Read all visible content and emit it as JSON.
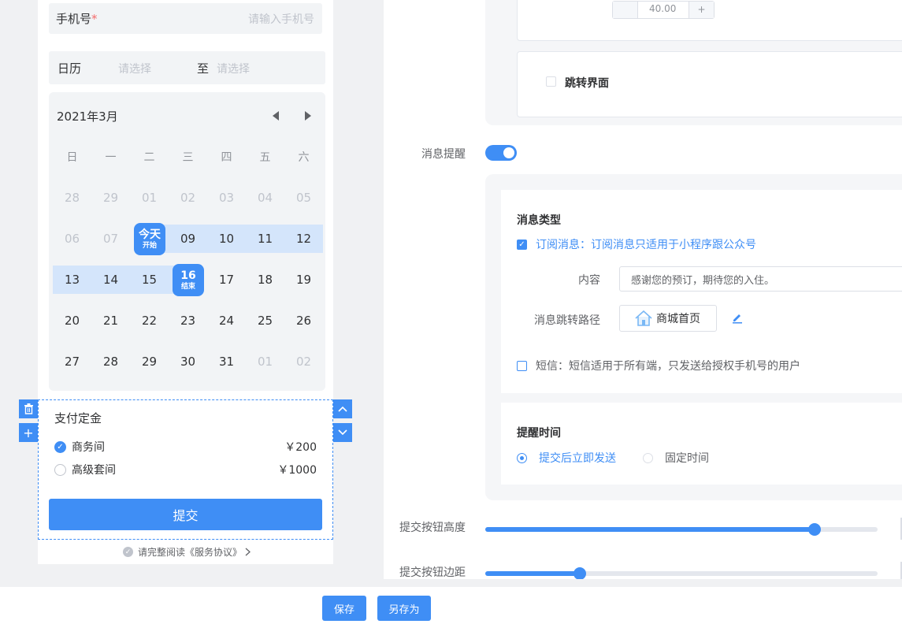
{
  "preview": {
    "phone_label": "手机号",
    "required_mark": "*",
    "phone_placeholder": "请输入手机号",
    "calendar_label": "日历",
    "start_placeholder": "请选择",
    "to_label": "至",
    "end_placeholder": "请选择",
    "calendar": {
      "title": "2021年3月",
      "weekdays": [
        "日",
        "一",
        "二",
        "三",
        "四",
        "五",
        "六"
      ],
      "rows": [
        [
          "28",
          "29",
          "01",
          "02",
          "03",
          "04",
          "05"
        ],
        [
          "06",
          "07",
          "今天",
          "09",
          "10",
          "11",
          "12"
        ],
        [
          "13",
          "14",
          "15",
          "16",
          "17",
          "18",
          "19"
        ],
        [
          "20",
          "21",
          "22",
          "23",
          "24",
          "25",
          "26"
        ],
        [
          "27",
          "28",
          "29",
          "30",
          "31",
          "01",
          "02"
        ]
      ],
      "start_sub": "开始",
      "end_sub": "结束"
    },
    "pay_title": "支付定金",
    "options": [
      {
        "name": "商务间",
        "price": "￥200",
        "selected": true
      },
      {
        "name": "高级套间",
        "price": "￥1000",
        "selected": false
      }
    ],
    "submit_label": "提交",
    "agreement": "请完整阅读《服务协议》",
    "tool_delete": "🗑",
    "tool_add": "+",
    "tool_up": "︿",
    "tool_down": "﹀"
  },
  "settings": {
    "top_partial_value": "40.00",
    "jump_page_label": "跳转界面",
    "message_reminder_label": "消息提醒",
    "message_reminder_on": true,
    "message_type_title": "消息类型",
    "subscribe_label": "订阅消息：订阅消息只适用于小程序跟公众号",
    "content_label": "内容",
    "content_value": "感谢您的预订，期待您的入住。",
    "path_label": "消息跳转路径",
    "path_value": "商城首页",
    "sms_label": "短信：短信适用于所有端，只发送给授权手机号的用户",
    "remind_time_title": "提醒时间",
    "remind_now": "提交后立即发送",
    "remind_fixed": "固定时间",
    "btn_height_label": "提交按钮高度",
    "btn_height_value": 0.84,
    "btn_margin_label": "提交按钮边距",
    "btn_margin_value": 0.24
  },
  "footer": {
    "save_label": "保存",
    "save_as_label": "另存为"
  },
  "colors": {
    "primary": "#3f8ef5",
    "range_bg": "#d4e5fb"
  }
}
